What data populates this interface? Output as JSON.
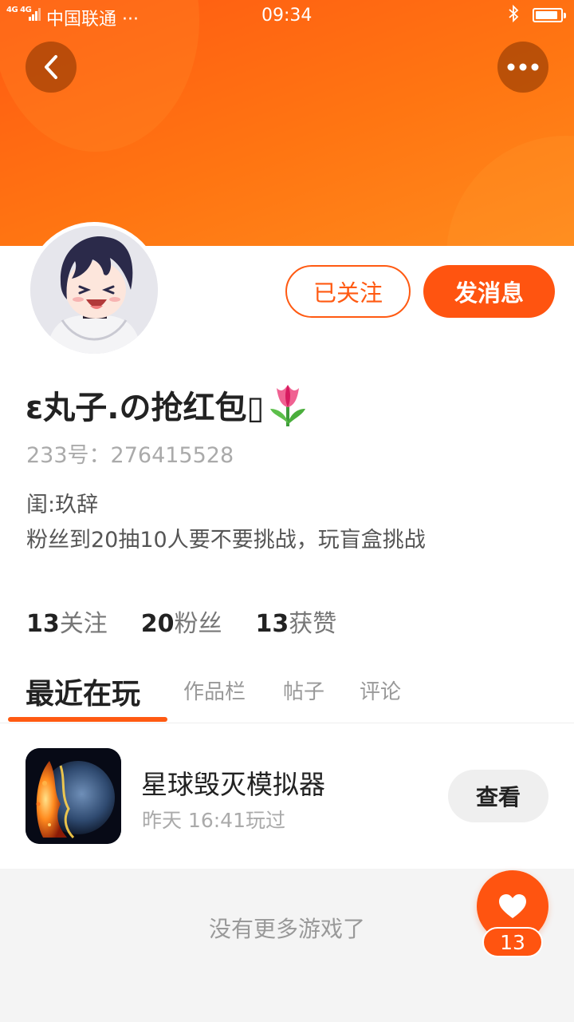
{
  "status_bar": {
    "network": "4G 4G",
    "carrier": "中国联通 ···",
    "time": "09:34",
    "bluetooth_icon": "bluetooth-icon",
    "battery_level": 0.9
  },
  "header": {
    "back_icon": "chevron-left-icon",
    "more_icon": "more-dots-icon",
    "accent_color": "#ff6a10"
  },
  "profile": {
    "avatar": "anime-avatar",
    "follow_label": "已关注",
    "message_label": "发消息",
    "nickname": "ε丸子.の抢红包▯",
    "nickname_emoji": "tulip-icon",
    "user_id": "233号：276415528",
    "bio_lines": [
      "闺:玖辞",
      "粉丝到20抽10人要不要挑战，玩盲盒挑战"
    ],
    "stats": [
      {
        "count": "13",
        "label": "关注"
      },
      {
        "count": "20",
        "label": "粉丝"
      },
      {
        "count": "13",
        "label": "获赞"
      }
    ]
  },
  "tabs": [
    {
      "label": "最近在玩",
      "active": true
    },
    {
      "label": "作品栏",
      "active": false
    },
    {
      "label": "帖子",
      "active": false
    },
    {
      "label": "评论",
      "active": false
    }
  ],
  "games": [
    {
      "title": "星球毁灭模拟器",
      "subtitle": "昨天 16:41玩过",
      "button_label": "查看",
      "icon": "planet-explosion-icon"
    }
  ],
  "footer": {
    "no_more_text": "没有更多游戏了",
    "like_icon": "heart-icon",
    "like_count": "13"
  }
}
